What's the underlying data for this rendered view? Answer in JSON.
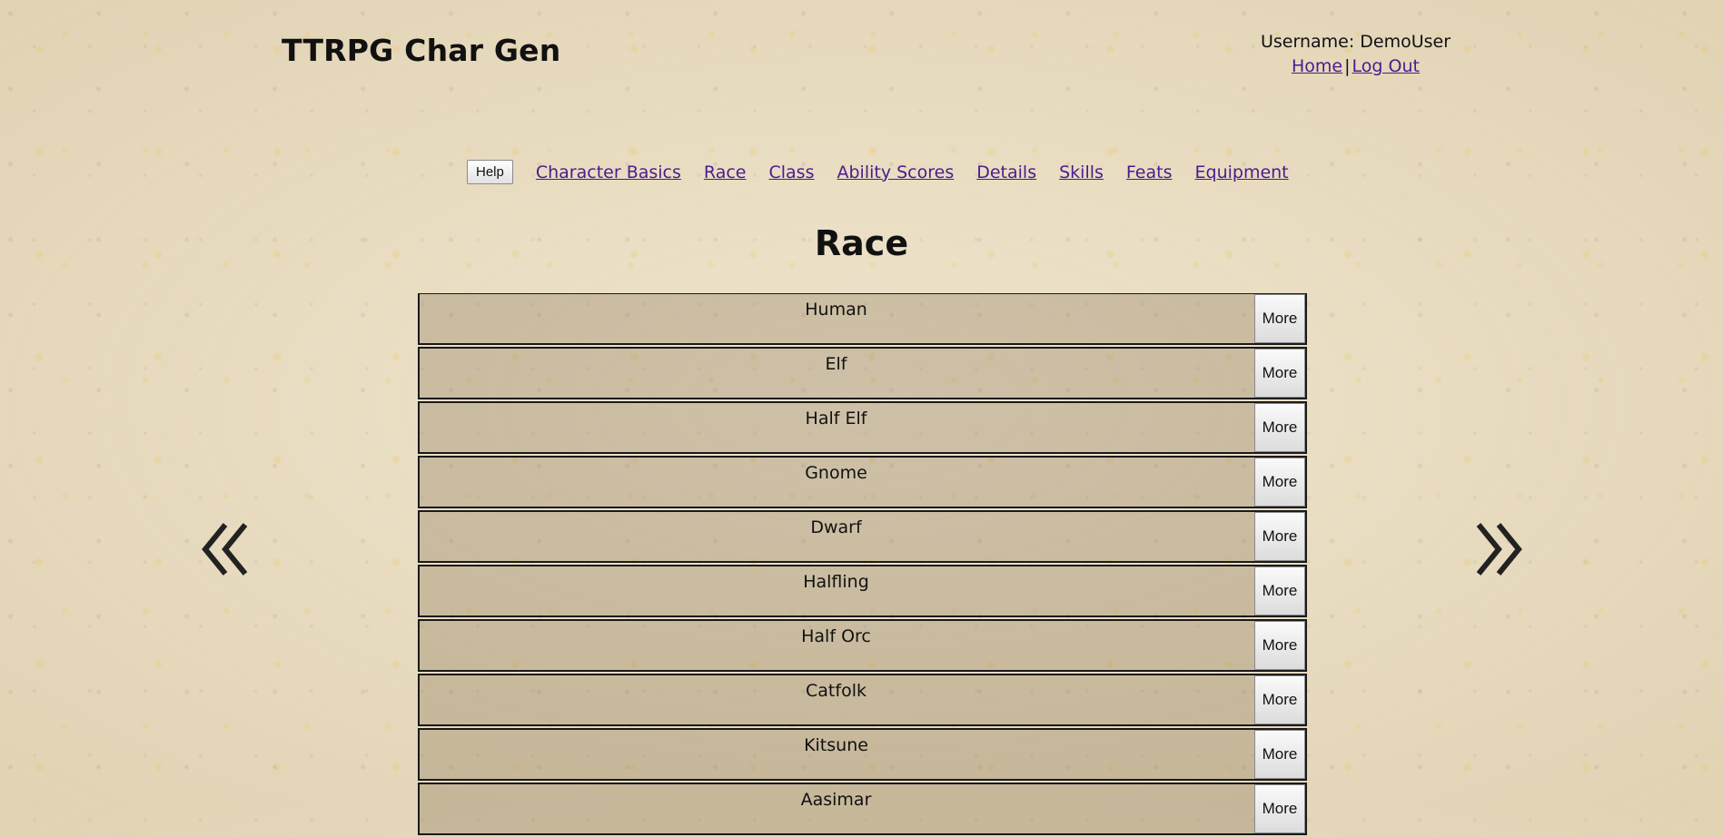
{
  "header": {
    "site_title": "TTRPG Char Gen",
    "username_label": "Username: DemoUser",
    "links": {
      "home": "Home",
      "separator": "|",
      "logout": "Log Out"
    }
  },
  "nav": {
    "help_label": "Help",
    "steps": [
      {
        "label": "Character Basics"
      },
      {
        "label": "Race"
      },
      {
        "label": "Class"
      },
      {
        "label": "Ability Scores"
      },
      {
        "label": "Details"
      },
      {
        "label": "Skills"
      },
      {
        "label": "Feats"
      },
      {
        "label": "Equipment"
      }
    ]
  },
  "page": {
    "heading": "Race",
    "prev_icon": "double-chevron-left-icon",
    "next_icon": "double-chevron-right-icon"
  },
  "races": [
    {
      "name": "Human",
      "more_label": "More"
    },
    {
      "name": "Elf",
      "more_label": "More"
    },
    {
      "name": "Half Elf",
      "more_label": "More"
    },
    {
      "name": "Gnome",
      "more_label": "More"
    },
    {
      "name": "Dwarf",
      "more_label": "More"
    },
    {
      "name": "Halfling",
      "more_label": "More"
    },
    {
      "name": "Half Orc",
      "more_label": "More"
    },
    {
      "name": "Catfolk",
      "more_label": "More"
    },
    {
      "name": "Kitsune",
      "more_label": "More"
    },
    {
      "name": "Aasimar",
      "more_label": "More"
    }
  ],
  "colors": {
    "link": "#4b1b8e",
    "text": "#111111",
    "background": "#e6d9bd"
  }
}
